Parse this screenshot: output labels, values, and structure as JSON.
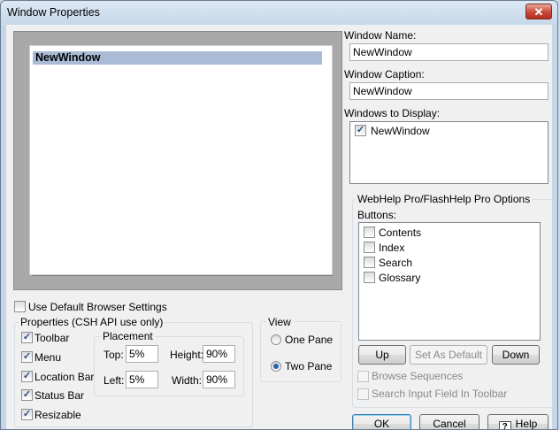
{
  "window": {
    "title": "Window Properties",
    "close_symbol": "✕"
  },
  "preview": {
    "window_name": "NewWindow"
  },
  "fields": {
    "window_name_label": "Window Name:",
    "window_name_value": "NewWindow",
    "window_caption_label": "Window Caption:",
    "window_caption_value": "NewWindow",
    "windows_to_display_label": "Windows to Display:",
    "windows_to_display_items": [
      {
        "label": "NewWindow",
        "checked": true
      }
    ]
  },
  "options": {
    "use_default_browser": {
      "label": "Use Default Browser Settings",
      "checked": false
    },
    "properties_group": "Properties (CSH API use only)",
    "toolbar": {
      "label": "Toolbar",
      "checked": true
    },
    "menu": {
      "label": "Menu",
      "checked": true
    },
    "location_bar": {
      "label": "Location Bar",
      "checked": true
    },
    "status_bar": {
      "label": "Status Bar",
      "checked": true
    },
    "resizable": {
      "label": "Resizable",
      "checked": true
    }
  },
  "placement": {
    "title": "Placement",
    "top_label": "Top:",
    "top_value": "5%",
    "height_label": "Height:",
    "height_value": "90%",
    "left_label": "Left:",
    "left_value": "5%",
    "width_label": "Width:",
    "width_value": "90%"
  },
  "view": {
    "title": "View",
    "one_pane": {
      "label": "One Pane",
      "selected": false
    },
    "two_pane": {
      "label": "Two Pane",
      "selected": true
    }
  },
  "webhelp": {
    "title": "WebHelp Pro/FlashHelp Pro Options",
    "buttons_label": "Buttons:",
    "items": [
      {
        "label": "Contents",
        "checked": false
      },
      {
        "label": "Index",
        "checked": false
      },
      {
        "label": "Search",
        "checked": false
      },
      {
        "label": "Glossary",
        "checked": false
      }
    ],
    "up_label": "Up",
    "set_default_label": "Set As Default",
    "down_label": "Down",
    "browse_sequences": {
      "label": "Browse Sequences",
      "checked": false
    },
    "search_input_field": {
      "label": "Search Input Field In Toolbar",
      "checked": false
    }
  },
  "footer": {
    "ok_label": "OK",
    "cancel_label": "Cancel",
    "help_label": "Help",
    "help_icon": "?"
  }
}
